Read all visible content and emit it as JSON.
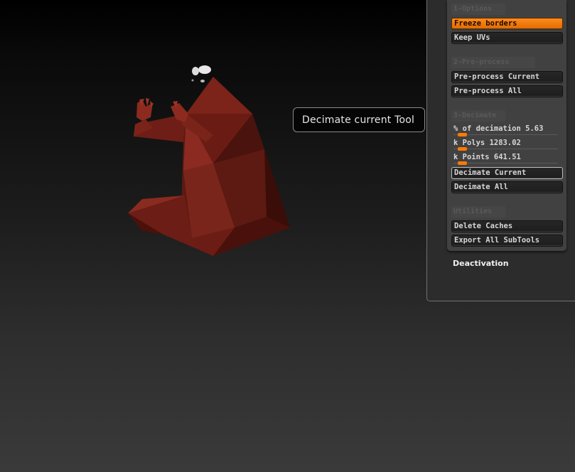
{
  "viewport": {
    "model_color": "#7a1f16"
  },
  "tooltip": {
    "text": "Decimate current Tool"
  },
  "panel": {
    "sections": {
      "options": "1-Options",
      "preprocess": "2-Pre-process",
      "decimate": "3-Decimate",
      "utilities": "Utilities"
    },
    "buttons": {
      "freeze_borders": "Freeze borders",
      "keep_uvs": "Keep UVs",
      "preprocess_current": "Pre-process Current",
      "preprocess_all": "Pre-process All",
      "decimate_current": "Decimate Current",
      "decimate_all": "Decimate All",
      "delete_caches": "Delete Caches",
      "export_all_subtools": "Export All SubTools"
    },
    "sliders": {
      "percent_decimation": {
        "label": "% of decimation",
        "value": "5.63"
      },
      "k_polys": {
        "label": "k Polys",
        "value": "1283.02"
      },
      "k_points": {
        "label": "k Points",
        "value": "641.51"
      }
    },
    "deactivation_label": "Deactivation",
    "accent_color": "#ff7a00"
  }
}
